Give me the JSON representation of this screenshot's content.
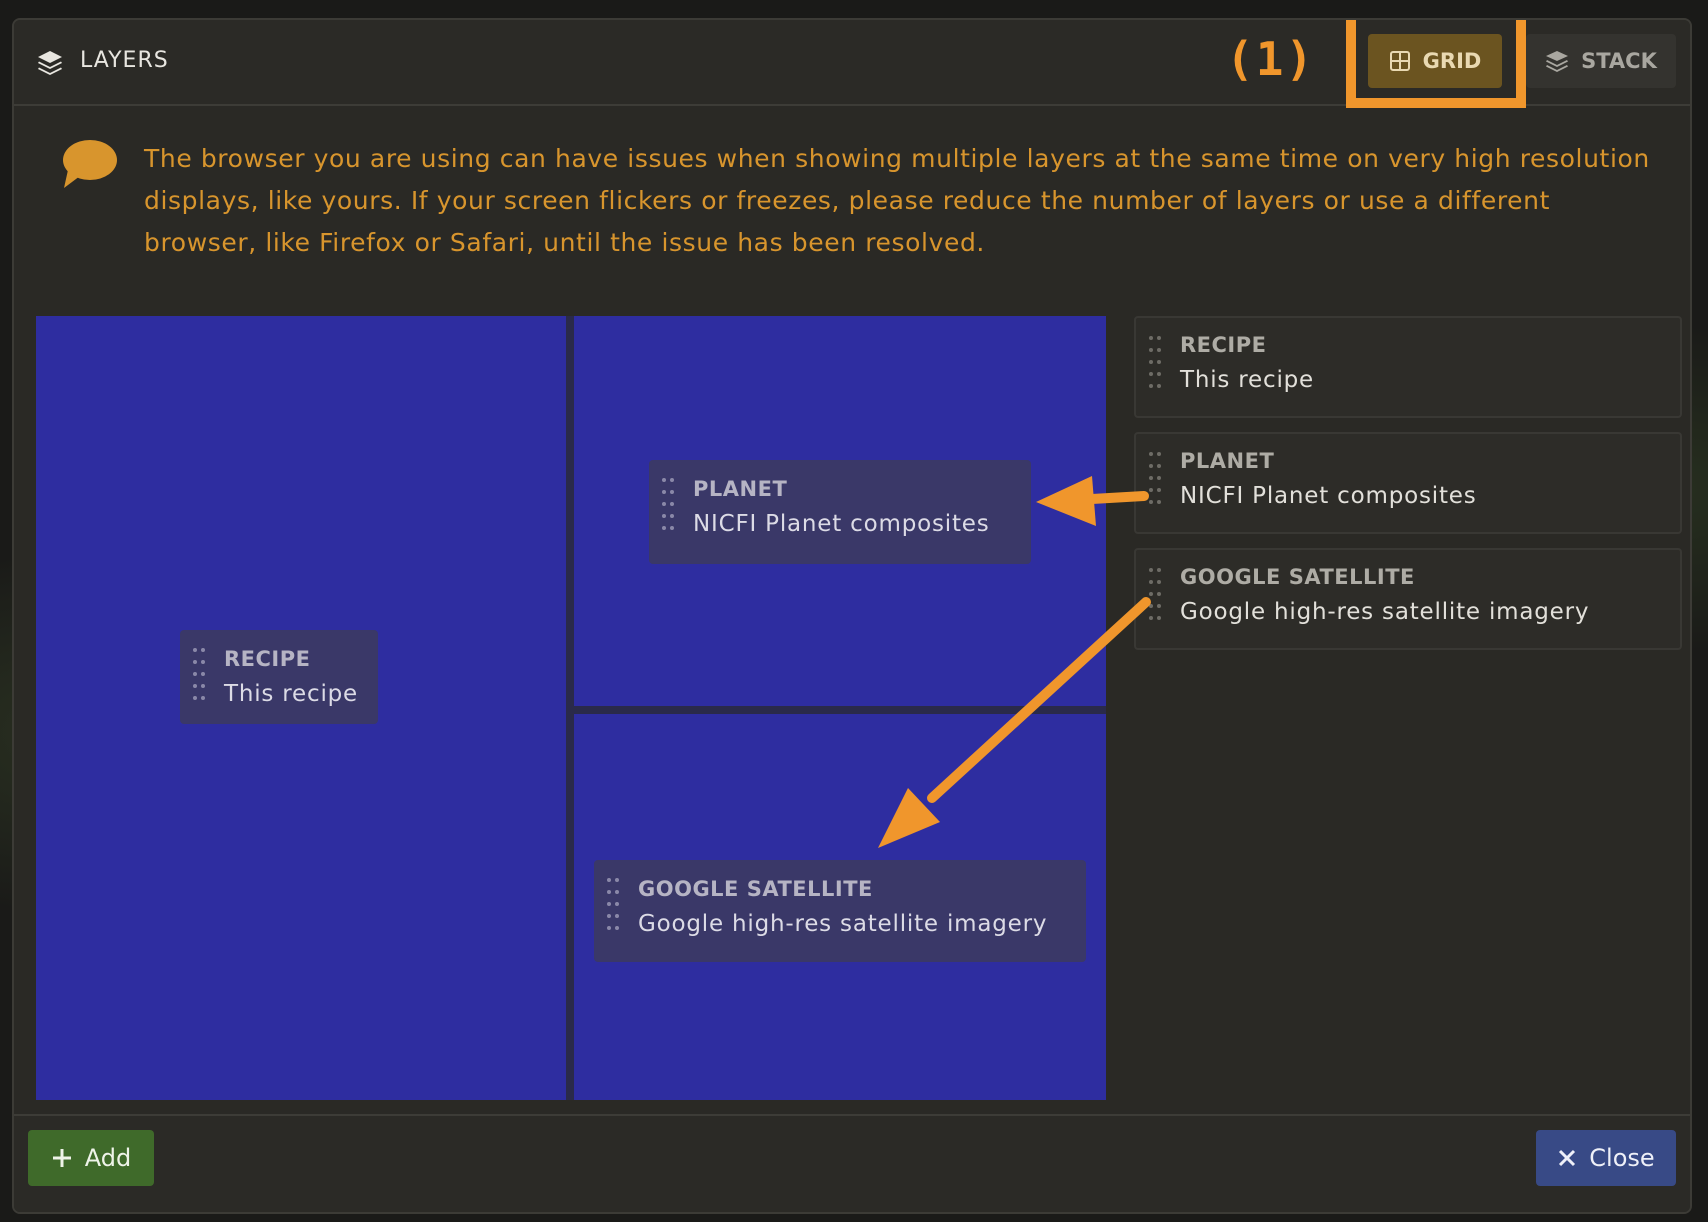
{
  "header": {
    "title": "LAYERS",
    "annotation": "(1)",
    "grid_label": "GRID",
    "stack_label": "STACK"
  },
  "warning": {
    "text": "The browser you are using can have issues when showing multiple layers at the same time on very high resolution displays, like yours. If your screen flickers or freezes, please reduce the number of layers or use a different browser, like Firefox or Safari, until the issue has been resolved."
  },
  "grid": {
    "cells": [
      {
        "type": "RECIPE",
        "description": "This recipe"
      },
      {
        "type": "PLANET",
        "description": "NICFI Planet composites"
      },
      {
        "type": "GOOGLE SATELLITE",
        "description": "Google high-res satellite imagery"
      }
    ]
  },
  "layer_list": [
    {
      "type": "RECIPE",
      "description": "This recipe"
    },
    {
      "type": "PLANET",
      "description": "NICFI Planet composites"
    },
    {
      "type": "GOOGLE SATELLITE",
      "description": "Google high-res satellite imagery"
    }
  ],
  "footer": {
    "add_label": "Add",
    "close_label": "Close"
  },
  "colors": {
    "accent_orange": "#f0962c",
    "grid_cell_blue": "#2e2da0",
    "add_green": "#3f6a2a",
    "close_blue": "#384a86"
  },
  "icons": {
    "title": "layers-icon",
    "grid": "grid-icon",
    "stack": "stack-icon",
    "warning": "speech-bubble-icon",
    "add": "plus-icon",
    "close": "close-icon"
  }
}
